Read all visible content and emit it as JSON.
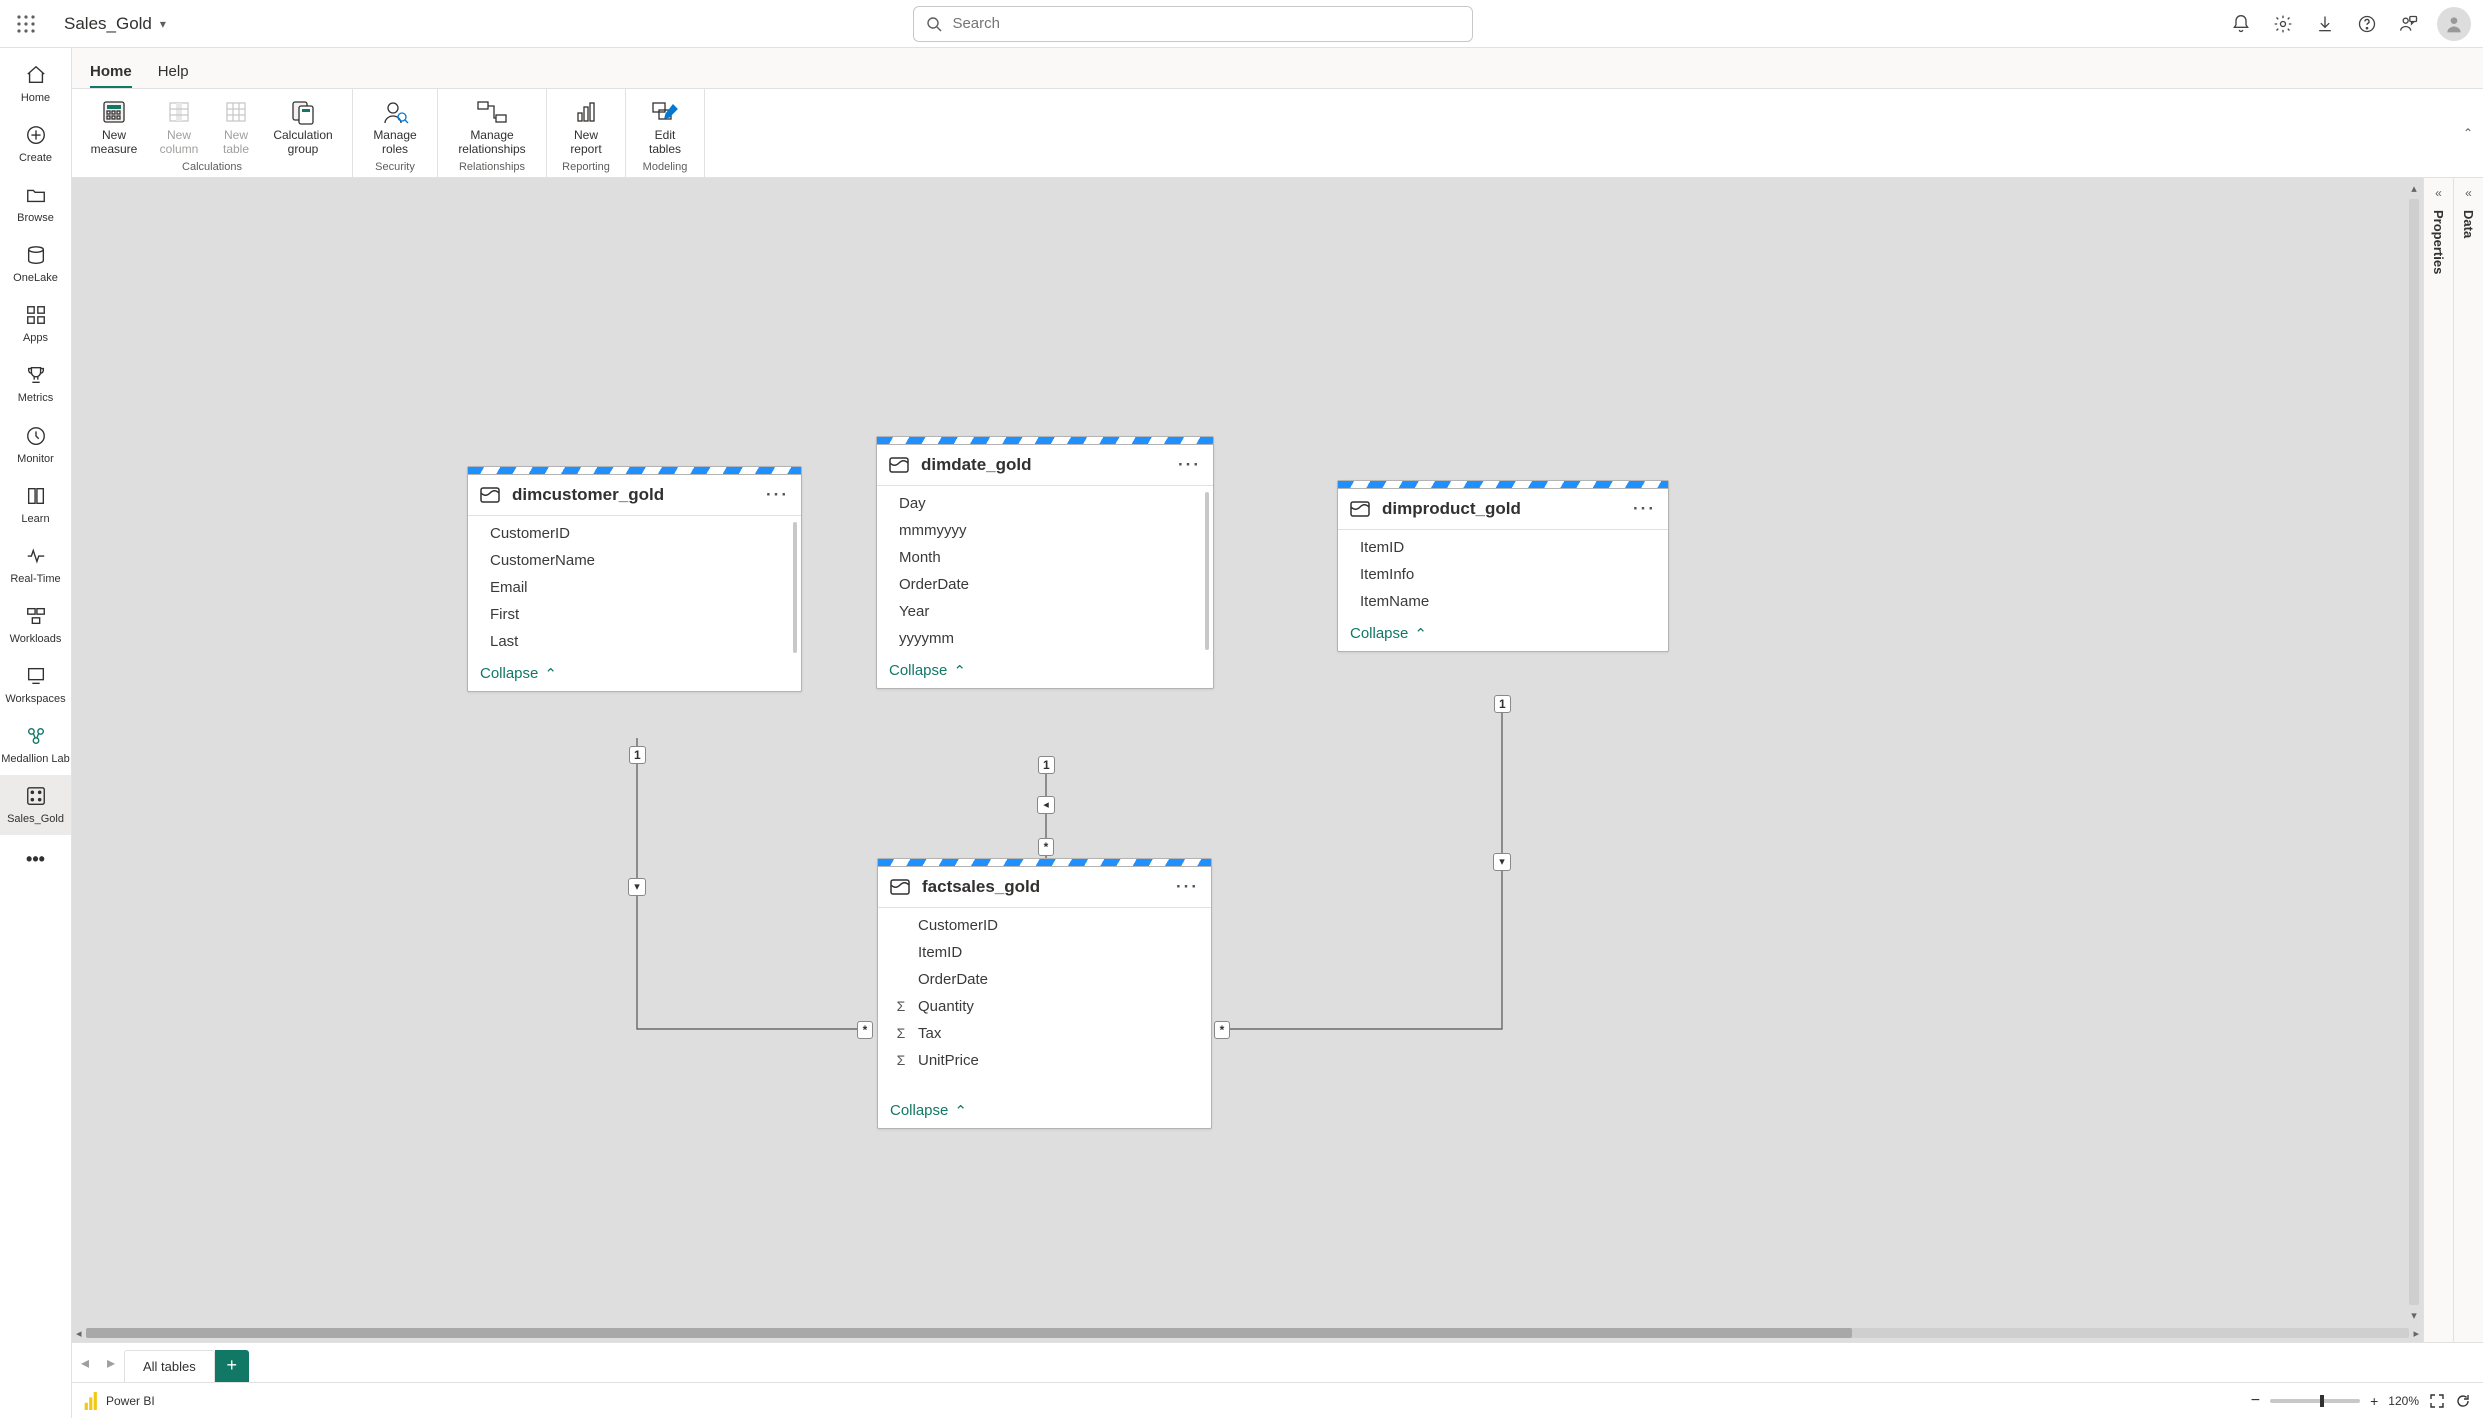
{
  "topbar": {
    "title": "Sales_Gold",
    "search_placeholder": "Search"
  },
  "leftrail": {
    "items": [
      {
        "id": "home",
        "label": "Home"
      },
      {
        "id": "create",
        "label": "Create"
      },
      {
        "id": "browse",
        "label": "Browse"
      },
      {
        "id": "onelake",
        "label": "OneLake"
      },
      {
        "id": "apps",
        "label": "Apps"
      },
      {
        "id": "metrics",
        "label": "Metrics"
      },
      {
        "id": "monitor",
        "label": "Monitor"
      },
      {
        "id": "learn",
        "label": "Learn"
      },
      {
        "id": "realtime",
        "label": "Real-Time"
      },
      {
        "id": "workloads",
        "label": "Workloads"
      },
      {
        "id": "workspaces",
        "label": "Workspaces"
      },
      {
        "id": "medallion",
        "label": "Medallion Lab"
      },
      {
        "id": "salesgold",
        "label": "Sales_Gold"
      }
    ]
  },
  "tabs": {
    "home": "Home",
    "help": "Help"
  },
  "ribbon": {
    "calculations": {
      "label": "Calculations",
      "new_measure": "New measure",
      "new_column": "New column",
      "new_table": "New table",
      "calc_group": "Calculation group"
    },
    "security": {
      "label": "Security",
      "manage_roles": "Manage roles"
    },
    "relationships": {
      "label": "Relationships",
      "manage_rel": "Manage relationships"
    },
    "reporting": {
      "label": "Reporting",
      "new_report": "New report"
    },
    "modeling": {
      "label": "Modeling",
      "edit_tables": "Edit tables"
    }
  },
  "rightpanes": {
    "properties": "Properties",
    "data": "Data"
  },
  "tables": {
    "dimcustomer": {
      "name": "dimcustomer_gold",
      "columns": [
        "CustomerID",
        "CustomerName",
        "Email",
        "First",
        "Last"
      ],
      "collapse": "Collapse"
    },
    "dimdate": {
      "name": "dimdate_gold",
      "columns": [
        "Day",
        "mmmyyyy",
        "Month",
        "OrderDate",
        "Year",
        "yyyymm"
      ],
      "collapse": "Collapse"
    },
    "dimproduct": {
      "name": "dimproduct_gold",
      "columns": [
        "ItemID",
        "ItemInfo",
        "ItemName"
      ],
      "collapse": "Collapse"
    },
    "factsales": {
      "name": "factsales_gold",
      "columns": [
        {
          "n": "CustomerID",
          "agg": false
        },
        {
          "n": "ItemID",
          "agg": false
        },
        {
          "n": "OrderDate",
          "agg": false
        },
        {
          "n": "Quantity",
          "agg": true
        },
        {
          "n": "Tax",
          "agg": true
        },
        {
          "n": "UnitPrice",
          "agg": true
        }
      ],
      "collapse": "Collapse"
    }
  },
  "cardinality": {
    "one": "1",
    "many": "*"
  },
  "bottomstrip": {
    "all_tables": "All tables"
  },
  "footer": {
    "brand": "Power BI",
    "zoom_minus": "−",
    "zoom_plus": "+",
    "zoom_value": "120%"
  }
}
